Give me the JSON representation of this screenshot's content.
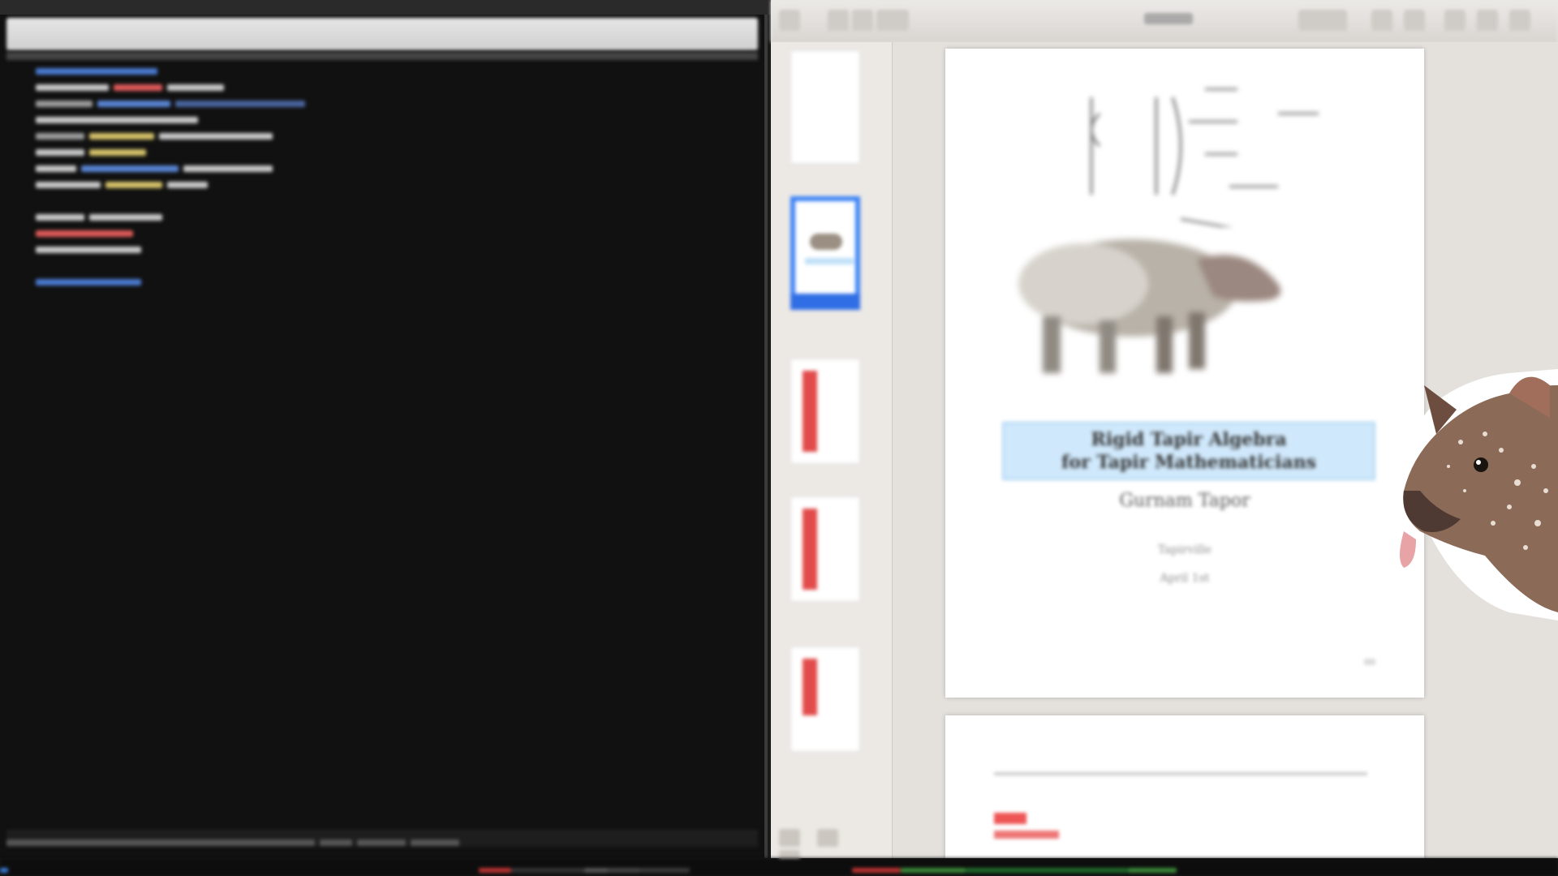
{
  "terminal": {
    "lines": [
      [
        {
          "w": 150,
          "c": "#4a7ad0"
        }
      ],
      [
        {
          "w": 90,
          "c": "#c9c9c9"
        },
        {
          "w": 60,
          "c": "#e05b5b"
        },
        {
          "w": 70,
          "c": "#c9c9c9"
        }
      ],
      [
        {
          "w": 70,
          "c": "#9d9d9d"
        },
        {
          "w": 90,
          "c": "#5b86d6"
        },
        {
          "w": 160,
          "c": "#4a66a0"
        }
      ],
      [
        {
          "w": 200,
          "c": "#c9c9c9"
        }
      ],
      [
        {
          "w": 60,
          "c": "#9d9d9d"
        },
        {
          "w": 80,
          "c": "#d6c36a"
        },
        {
          "w": 140,
          "c": "#c9c9c9"
        }
      ],
      [
        {
          "w": 60,
          "c": "#c9c9c9"
        },
        {
          "w": 70,
          "c": "#d6c36a"
        }
      ],
      [
        {
          "w": 50,
          "c": "#c9c9c9"
        },
        {
          "w": 120,
          "c": "#5b86d6"
        },
        {
          "w": 110,
          "c": "#c9c9c9"
        }
      ],
      [
        {
          "w": 80,
          "c": "#c9c9c9"
        },
        {
          "w": 70,
          "c": "#d6c36a"
        },
        {
          "w": 50,
          "c": "#c9c9c9"
        }
      ],
      [
        {
          "w": 0,
          "c": "#111"
        }
      ],
      [
        {
          "w": 60,
          "c": "#c9c9c9"
        },
        {
          "w": 90,
          "c": "#c9c9c9"
        }
      ],
      [
        {
          "w": 120,
          "c": "#e05b5b"
        }
      ],
      [
        {
          "w": 130,
          "c": "#c9c9c9"
        }
      ],
      [
        {
          "w": 0,
          "c": "#111"
        }
      ],
      [
        {
          "w": 130,
          "c": "#4a7ad0"
        }
      ]
    ],
    "status_segments": [
      {
        "w": 380
      },
      {
        "w": 40
      },
      {
        "w": 60
      },
      {
        "w": 60
      }
    ]
  },
  "viewer": {
    "page1": {
      "title_line1": "Rigid Tapir Algebra",
      "title_line2": "for Tapir Mathematicians",
      "author": "Gurnam Tapor",
      "institution": "Tapirville",
      "date": "April 1st"
    }
  },
  "dock_segments": [
    {
      "w": 10,
      "c": "#3a7bd5"
    },
    {
      "w": 580,
      "c": "#0d0d0d"
    },
    {
      "w": 40,
      "c": "#b33"
    },
    {
      "w": 90,
      "c": "#333"
    },
    {
      "w": 30,
      "c": "#555"
    },
    {
      "w": 40,
      "c": "#444"
    },
    {
      "w": 60,
      "c": "#3a3a3a"
    },
    {
      "w": 200,
      "c": "#0d0d0d"
    },
    {
      "w": 60,
      "c": "#b33"
    },
    {
      "w": 80,
      "c": "#3a8a3a"
    },
    {
      "w": 200,
      "c": "#1f6a2a"
    },
    {
      "w": 60,
      "c": "#3a8a3a"
    }
  ]
}
